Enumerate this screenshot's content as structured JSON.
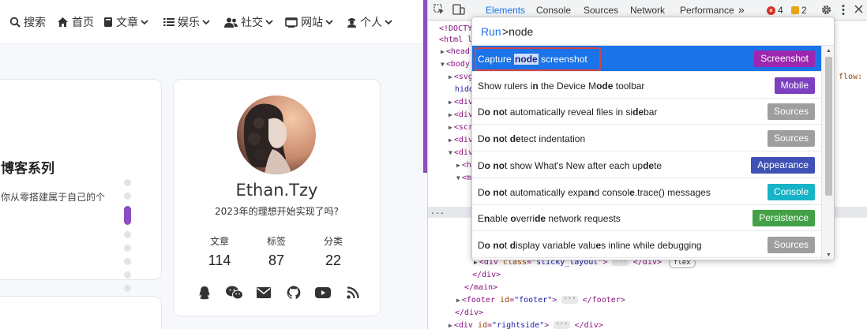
{
  "blog": {
    "nav": [
      {
        "label": "搜索",
        "icon": "search-icon",
        "caret": false
      },
      {
        "label": "首页",
        "icon": "home-icon",
        "caret": false
      },
      {
        "label": "文章",
        "icon": "book-icon",
        "caret": true
      },
      {
        "label": "娱乐",
        "icon": "list-icon",
        "caret": true
      },
      {
        "label": "社交",
        "icon": "users-icon",
        "caret": true
      },
      {
        "label": "网站",
        "icon": "window-icon",
        "caret": true
      },
      {
        "label": "个人",
        "icon": "person-icon",
        "caret": true
      }
    ],
    "post": {
      "title": "博客系列",
      "excerpt": "你从零搭建属于自己的个"
    },
    "profile": {
      "name": "Ethan.Tzy",
      "motto": "2023年的理想开始实现了吗?",
      "stats": [
        {
          "label": "文章",
          "value": "114"
        },
        {
          "label": "标签",
          "value": "87"
        },
        {
          "label": "分类",
          "value": "22"
        }
      ],
      "social_icons": [
        "qq-icon",
        "wechat-icon",
        "mail-icon",
        "github-icon",
        "youtube-icon",
        "rss-icon"
      ]
    }
  },
  "devtools": {
    "tabs": [
      "Elements",
      "Console",
      "Sources",
      "Network",
      "Performance"
    ],
    "active_tab": "Elements",
    "more_tabs": "»",
    "errors_count": "4",
    "warnings_count": "2",
    "dom_prefix": {
      "doctype": "<!DOCTY",
      "html": "<html l",
      "head": "<head",
      "body": "<body",
      "svg_line": "<svg",
      "svg_suffix": "flow:",
      "svg_hidden": "hidd",
      "div1": "<div",
      "div2": "<div",
      "script": "<scri",
      "div3": "<div",
      "div4": "<div",
      "h": "<h",
      "m1": "<m",
      "ellipsis": "..."
    },
    "dom_lines": {
      "sticky_open": "<div",
      "sticky_attr_name": "class",
      "sticky_attr_value": "\"sticky_layout\"",
      "sticky_gt": ">",
      "sticky_close": "</div>",
      "flex_badge": "flex",
      "div_close": "</div>",
      "main_close": "</main>",
      "footer_open": "<footer",
      "footer_attr_name": "id",
      "footer_attr_value": "\"footer\"",
      "footer_gt": ">",
      "footer_close": "</footer>",
      "div_close2": "</div>",
      "rightside_open": "<div",
      "rightside_attr_name": "id",
      "rightside_attr_value": "\"rightside\"",
      "rightside_gt": ">",
      "rightside_close": "</div>"
    },
    "command_menu": {
      "prefix": "Run",
      "query": ">node",
      "items": [
        {
          "label_html": "Capture <b>node</b> screenshot",
          "tag": "Screenshot",
          "tag_color": "#9c27b0",
          "selected": true
        },
        {
          "label_html": "Show rulers i<b>n</b> the Device M<b>ode</b> toolbar",
          "tag": "Mobile",
          "tag_color": "#7b3fbf",
          "selected": false
        },
        {
          "label_html": "D<b>o</b> <b>no</b>t automatically reveal files in si<b>de</b>bar",
          "tag": "Sources",
          "tag_color": "#9e9e9e",
          "selected": false
        },
        {
          "label_html": "D<b>o</b> <b>no</b>t <b>de</b>tect indentation",
          "tag": "Sources",
          "tag_color": "#9e9e9e",
          "selected": false
        },
        {
          "label_html": "D<b>o</b> <b>no</b>t show What's New after each up<b>de</b>te",
          "tag": "Appearance",
          "tag_color": "#3f51b5",
          "selected": false
        },
        {
          "label_html": "D<b>o</b> <b>no</b>t automatically expa<b>n</b>d consol<b>e</b>.trace() messages",
          "tag": "Console",
          "tag_color": "#17b3c6",
          "selected": false
        },
        {
          "label_html": "E<b>n</b>able <b>o</b>verri<b>de</b> network requests",
          "tag": "Persistence",
          "tag_color": "#43a047",
          "selected": false
        },
        {
          "label_html": "D<b>o</b> <b>no</b>t <b>d</b>isplay variable valu<b>e</b>s inline while debugging",
          "tag": "Sources",
          "tag_color": "#9e9e9e",
          "selected": false
        }
      ]
    }
  }
}
